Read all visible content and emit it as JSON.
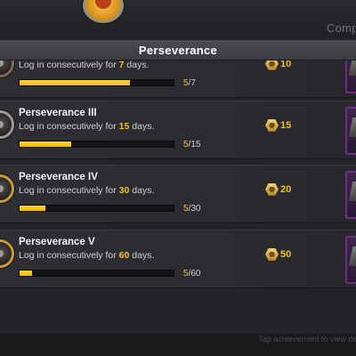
{
  "top": {
    "corner_label": "Compl"
  },
  "panel": {
    "title": "Perseverance"
  },
  "achievements": [
    {
      "name": "",
      "desc_prefix": "Log in consecutively for ",
      "days": "7",
      "desc_suffix": " days.",
      "current": "5",
      "total": "/7",
      "progress": 0.714,
      "reward": "10",
      "badge_tier": "bronze"
    },
    {
      "name": "Perseverance III",
      "desc_prefix": "Log in consecutively for ",
      "days": "15",
      "desc_suffix": " days.",
      "current": "5",
      "total": "/15",
      "progress": 0.333,
      "reward": "15",
      "badge_tier": "silver"
    },
    {
      "name": "Perseverance IV",
      "desc_prefix": "Log in consecutively for ",
      "days": "30",
      "desc_suffix": " days.",
      "current": "5",
      "total": "/30",
      "progress": 0.167,
      "reward": "20",
      "badge_tier": "gold"
    },
    {
      "name": "Perseverance V",
      "desc_prefix": "Log in consecutively for ",
      "days": "60",
      "desc_suffix": " days.",
      "current": "5",
      "total": "/60",
      "progress": 0.083,
      "reward": "50",
      "badge_tier": "gold"
    }
  ],
  "footer": {
    "hint": "Tap achievement to view det"
  },
  "icons": {
    "reward": "coin-icon",
    "badge": "medal-icon",
    "reward_item": "reward-item-icon"
  },
  "colors": {
    "accent": "#f2c21a",
    "panel_bg": "#232427",
    "header_bg": "#45474c"
  }
}
